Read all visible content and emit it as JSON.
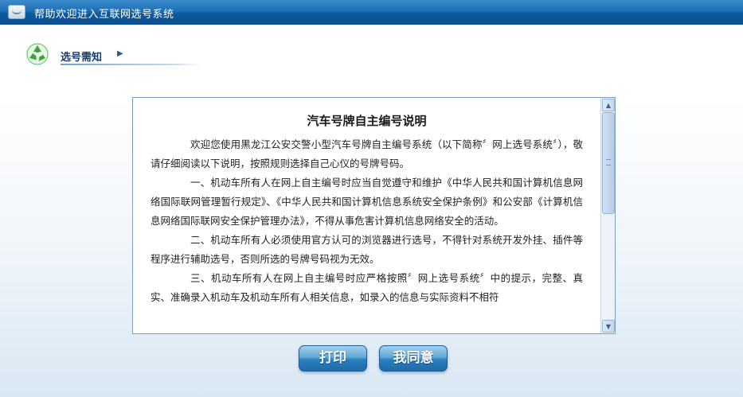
{
  "window": {
    "title": "帮助欢迎进入互联网选号系统"
  },
  "section": {
    "title": "选号需知"
  },
  "notice": {
    "heading": "汽车号牌自主编号说明",
    "paragraphs": [
      "欢迎您使用黑龙江公安交警小型汽车号牌自主编号系统（以下简称〞网上选号系统〞），敬请仔细阅读以下说明，按照规则选择自己心仪的号牌号码。",
      "一、机动车所有人在网上自主编号时应当自觉遵守和维护《中华人民共和国计算机信息网络国际联网管理暂行规定》、《中华人民共和国计算机信息系统安全保护条例》和公安部《计算机信息网络国际联网安全保护管理办法》，不得从事危害计算机信息网络安全的活动。",
      "二、机动车所有人必须使用官方认可的浏览器进行选号，不得针对系统开发外挂、插件等程序进行辅助选号，否则所选的号牌号码视为无效。",
      "三、机动车所有人在网上自主编号时应严格按照〞网上选号系统〞中的提示，完整、真实、准确录入机动车及机动车所有人相关信息，如录入的信息与实际资料不相符"
    ]
  },
  "buttons": {
    "print": "打印",
    "agree": "我同意"
  },
  "icons": {
    "window": "window-icon",
    "section": "recycle-icon",
    "arrow": "arrow-right-icon",
    "scroll_up": "scroll-up-icon",
    "scroll_down": "scroll-down-icon"
  },
  "colors": {
    "titlebar": "#1d6fb4",
    "button": "#2c80bf",
    "section_title": "#1a3c6e",
    "recycle": "#3aa33a"
  }
}
